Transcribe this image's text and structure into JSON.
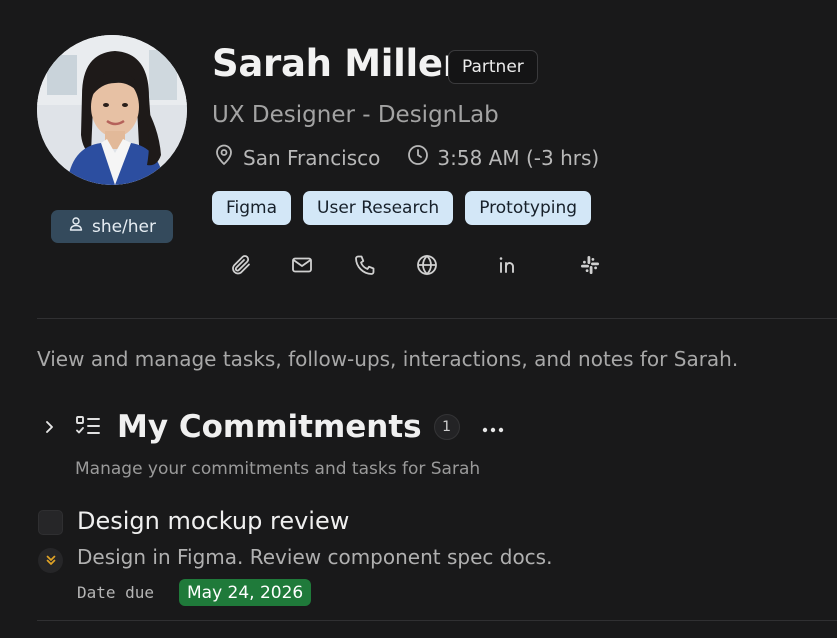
{
  "contact": {
    "name": "Sarah Miller",
    "relationship": "Partner",
    "title": "UX Designer - DesignLab",
    "location": "San Francisco",
    "local_time": "3:58 AM (-3 hrs)",
    "pronouns": "she/her",
    "tags": [
      "Figma",
      "User Research",
      "Prototyping"
    ],
    "actions": [
      {
        "name": "attachment",
        "icon": "paperclip-icon"
      },
      {
        "name": "email",
        "icon": "mail-icon"
      },
      {
        "name": "phone",
        "icon": "phone-icon"
      },
      {
        "name": "website",
        "icon": "globe-icon"
      },
      {
        "name": "linkedin",
        "icon": "linkedin-icon"
      },
      {
        "name": "slack",
        "icon": "slack-icon"
      }
    ]
  },
  "description": "View and manage tasks, follow-ups, interactions, and notes for Sarah.",
  "section": {
    "title": "My Commitments",
    "count": "1",
    "subtitle": "Manage your commitments and tasks for Sarah"
  },
  "task": {
    "title": "Design mockup review",
    "description": "Design in Figma. Review component spec docs.",
    "due_label": "Date due",
    "due_date": "May 24, 2026",
    "due_color": "#1f7a3a",
    "priority_color": "#e0a326"
  },
  "colors": {
    "background": "#19191a",
    "tag_bg": "#d3e7f7",
    "pronoun_bg": "#344a5c"
  }
}
